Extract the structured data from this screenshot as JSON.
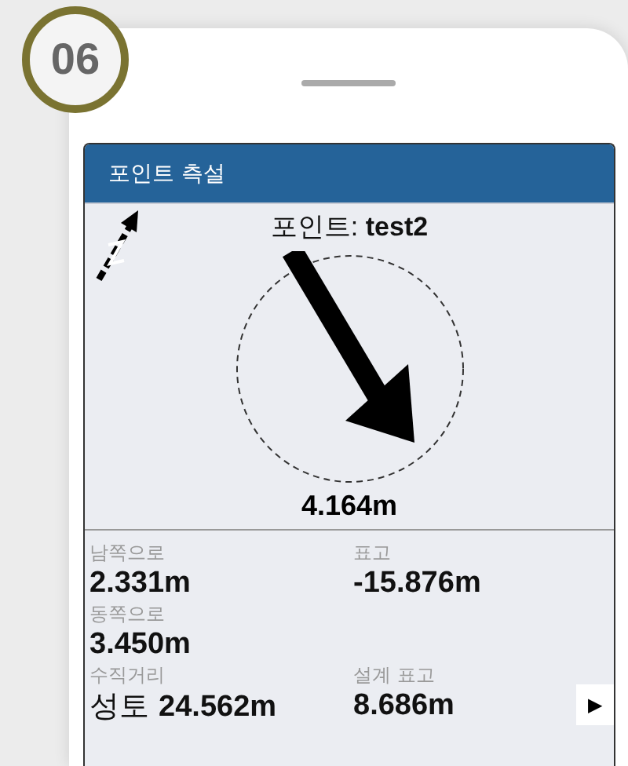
{
  "step_badge": "06",
  "panel": {
    "title": "포인트 측설"
  },
  "point": {
    "label": "포인트:",
    "name": "test2"
  },
  "distance": "4.164m",
  "reading_rows": [
    {
      "cells": [
        {
          "label": "남쪽으로",
          "value": "2.331m"
        },
        {
          "label": "표고",
          "value": "-15.876m"
        }
      ]
    },
    {
      "cells": [
        {
          "label": "동쪽으로",
          "value": "3.450m"
        }
      ]
    },
    {
      "cells": [
        {
          "label": "수직거리",
          "prefix": "성토",
          "value": "24.562m"
        },
        {
          "label": "설계 표고",
          "value": "8.686m"
        }
      ]
    }
  ],
  "next_button": "▶"
}
